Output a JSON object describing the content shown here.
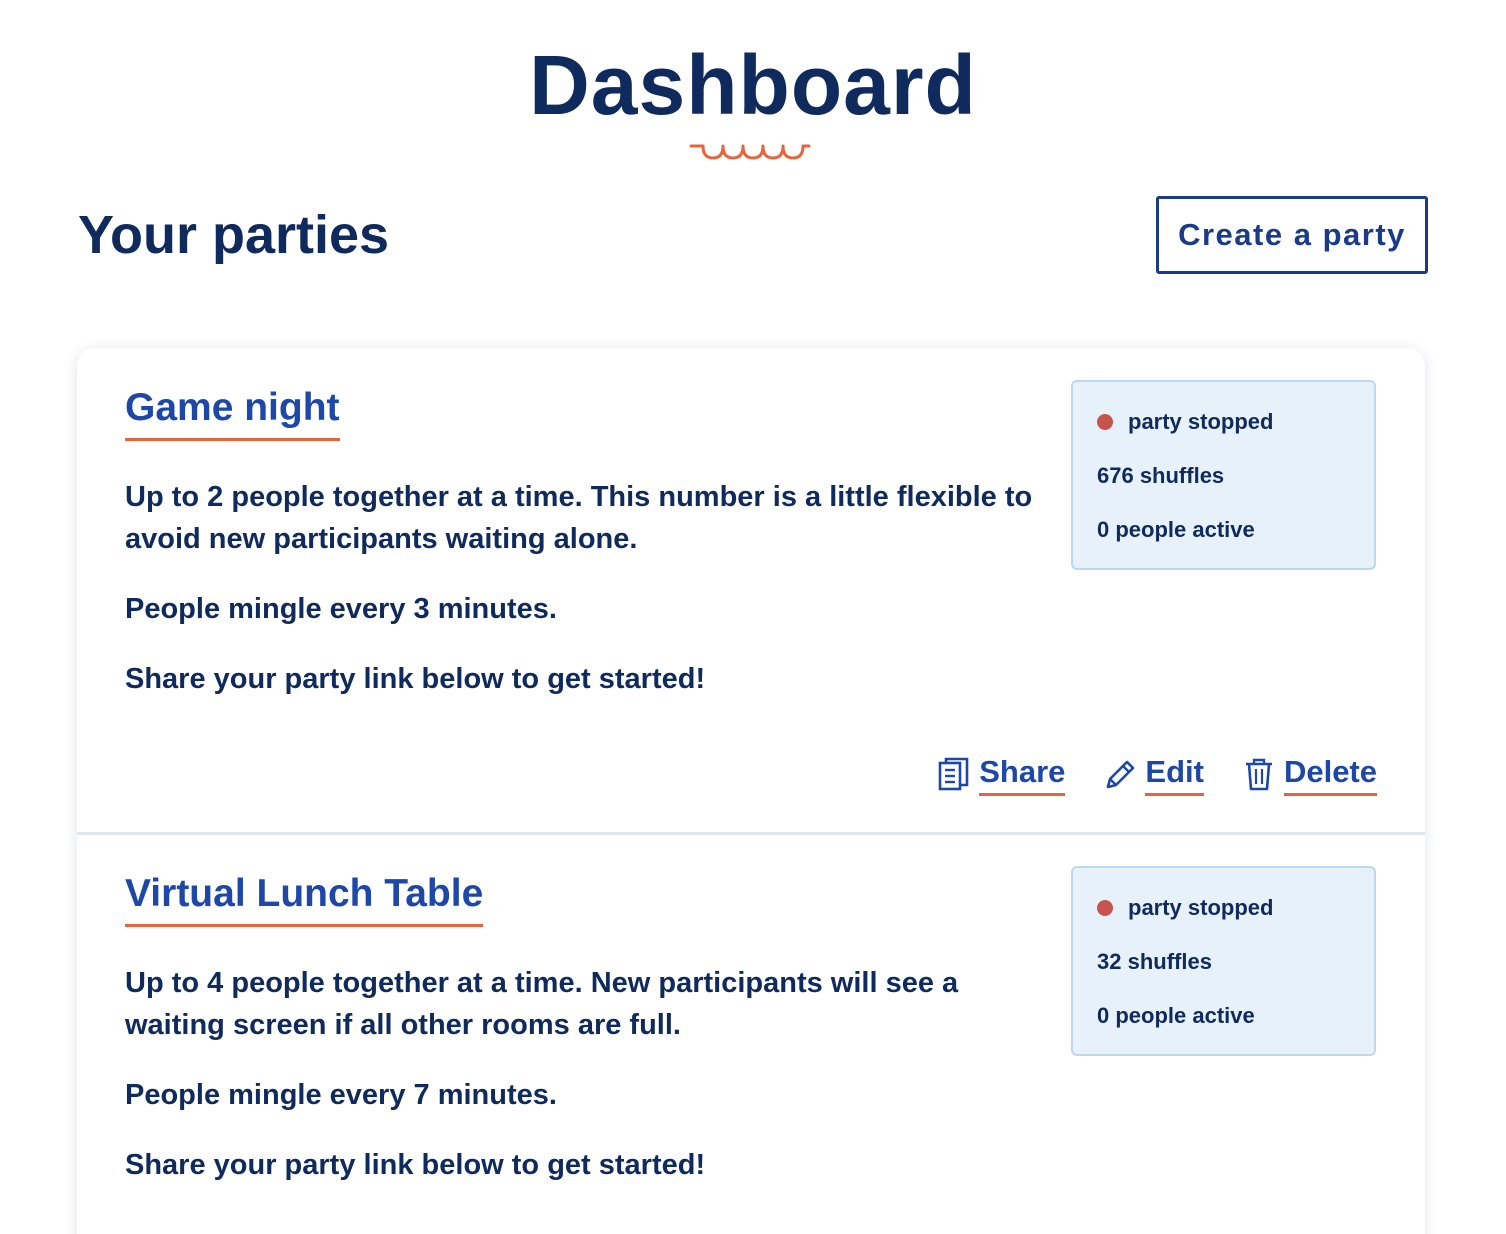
{
  "page": {
    "title": "Dashboard"
  },
  "section": {
    "title": "Your parties",
    "create_label": "Create a party"
  },
  "parties": [
    {
      "name": "Game night",
      "desc_prefix": "Up to ",
      "group_size": "2",
      "desc_suffix": " people together at a time. This number is a little flexible to avoid new participants waiting alone.",
      "mingle_prefix": "People mingle every ",
      "mingle_minutes": "3",
      "mingle_suffix": " minutes.",
      "share_hint": "Share your party link below to get started!",
      "status": {
        "state": "party stopped",
        "shuffles": "676 shuffles",
        "active": "0 people active"
      },
      "actions": {
        "share": "Share",
        "edit": "Edit",
        "delete": "Delete"
      }
    },
    {
      "name": "Virtual Lunch Table",
      "desc_prefix": "Up to ",
      "group_size": "4",
      "desc_suffix": " people together at a time. New participants will see a waiting screen if all other rooms are full.",
      "mingle_prefix": "People mingle every ",
      "mingle_minutes": "7",
      "mingle_suffix": " minutes.",
      "share_hint": "Share your party link below to get started!",
      "status": {
        "state": "party stopped",
        "shuffles": "32 shuffles",
        "active": "0 people active"
      }
    }
  ],
  "colors": {
    "navy": "#0f2a5c",
    "link_blue": "#1d47a8",
    "accent_orange": "#e8643a",
    "status_bg": "#e6f1fa",
    "stopped_dot": "#c9534f"
  },
  "icons": {
    "share": "document-copy-icon",
    "edit": "pencil-icon",
    "delete": "trash-icon"
  }
}
